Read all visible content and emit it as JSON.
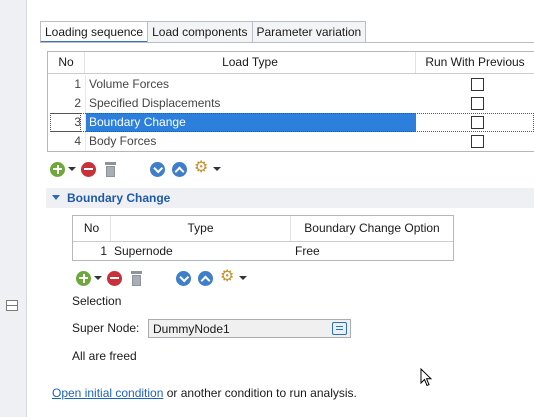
{
  "tabs": [
    {
      "label": "Loading sequence",
      "active": true
    },
    {
      "label": "Load components",
      "active": false
    },
    {
      "label": "Parameter variation",
      "active": false
    }
  ],
  "sequence_table": {
    "columns": [
      "No",
      "Load Type",
      "Run With Previous"
    ],
    "rows": [
      {
        "no": "1",
        "type": "Volume Forces",
        "run_with_previous": false
      },
      {
        "no": "2",
        "type": "Specified Displacements",
        "run_with_previous": false
      },
      {
        "no": "3",
        "type": "Boundary Change",
        "run_with_previous": false,
        "selected": true
      },
      {
        "no": "4",
        "type": "Body Forces",
        "run_with_previous": false
      }
    ]
  },
  "toolbar_icons": [
    "add-icon",
    "dropdown-caret",
    "remove-icon",
    "trash-icon",
    "move-down-icon",
    "move-up-icon",
    "gear-icon",
    "dropdown-caret"
  ],
  "section": {
    "title": "Boundary Change",
    "expanded": true
  },
  "boundary_table": {
    "columns": [
      "No",
      "Type",
      "Boundary Change Option"
    ],
    "rows": [
      {
        "no": "1",
        "type": "Supernode",
        "option": "Free"
      }
    ]
  },
  "selection_label": "Selection",
  "super_node": {
    "label": "Super Node:",
    "value": "DummyNode1"
  },
  "status_text": "All are freed",
  "footer": {
    "link": "Open initial condition",
    "text": "or another condition to run analysis."
  },
  "colors": {
    "accent": "#2c7fdb",
    "link": "#1d63b8",
    "section_title": "#1f5aa6",
    "add": "#6fa83a",
    "remove": "#c8313a"
  }
}
